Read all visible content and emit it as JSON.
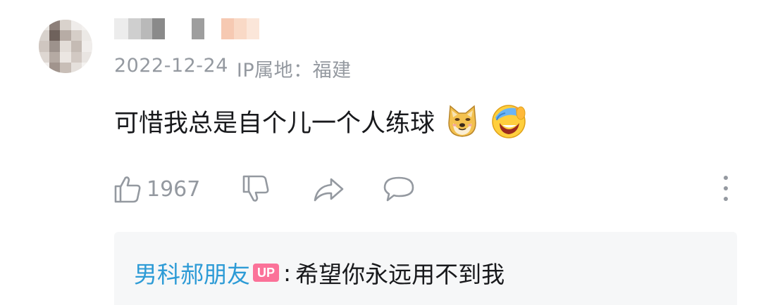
{
  "comment": {
    "date": "2022-12-24",
    "ip_location": "IP属地：福建",
    "text": "可惜我总是自个儿一个人练球",
    "emojis": [
      "doge-emoji",
      "laughing-cry-emoji"
    ],
    "like_count": "1967"
  },
  "reply": {
    "username": "男科郝朋友",
    "badge": "UP",
    "colon": ":",
    "text": "希望你永远用不到我"
  },
  "colors": {
    "meta_gray": "#9499a0",
    "reply_user_blue": "#2d9bd6",
    "up_badge_pink": "#fb7299",
    "reply_bg": "#f6f7f8"
  },
  "icons": [
    "thumbs-up-icon",
    "thumbs-down-icon",
    "share-icon",
    "reply-icon",
    "more-icon"
  ]
}
